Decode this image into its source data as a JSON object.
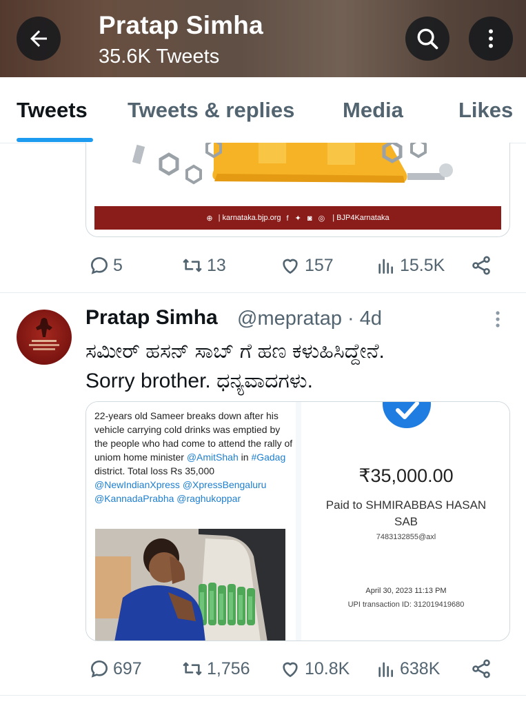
{
  "header": {
    "title": "Pratap Simha",
    "tweet_count": "35.6K Tweets",
    "back_icon": "arrow-left-icon",
    "search_icon": "search-icon",
    "more_icon": "more-vertical-icon"
  },
  "tabs": [
    {
      "label": "Tweets",
      "active": true
    },
    {
      "label": "Tweets & replies",
      "active": false
    },
    {
      "label": "Media",
      "active": false
    },
    {
      "label": "Likes",
      "active": false
    }
  ],
  "previous_tweet": {
    "card_footer": "| karnataka.bjp.org",
    "card_footer_handle": "| BJP4Karnataka",
    "actions": {
      "replies": "5",
      "retweets": "13",
      "likes": "157",
      "views": "15.5K"
    }
  },
  "tweet": {
    "name": "Pratap Simha",
    "handle_time": "@mepratap · 4d",
    "text_line1": "ಸಮೀರ್ ಹಸನ್ ಸಾಬ್ ಗೆ ಹಣ ಕಳುಹಿಸಿದ್ದೇನೆ.",
    "text_line2": "Sorry brother. ಧನ್ಯವಾದಗಳು.",
    "media_left": {
      "news_text": "22-years old Sameer breaks down after his vehicle carrying cold drinks was emptied by the people who had come to attend the rally of uniom home minister",
      "mention1": "@AmitShah",
      "word_in": " in ",
      "hashtag": "#Gadag",
      "text_after": " district. Total loss Rs 35,000",
      "mentions_line": "@NewIndianXpress @XpressBengaluru @KannadaPrabha @raghukoppar"
    },
    "media_right": {
      "amount": "₹35,000.00",
      "paid_to": "Paid to SHMIRABBAS HASAN SAB",
      "upi_id": "7483132855@axl",
      "date": "April 30, 2023 11:13 PM",
      "txn_id": "UPI transaction ID: 312019419680"
    },
    "actions": {
      "replies": "697",
      "retweets": "1,756",
      "likes": "10.8K",
      "views": "638K"
    }
  },
  "colors": {
    "accent": "#1d9bf0",
    "secondary_text": "#536471",
    "primary_text": "#0f1419",
    "bjp_footer": "#8a1c1a"
  }
}
